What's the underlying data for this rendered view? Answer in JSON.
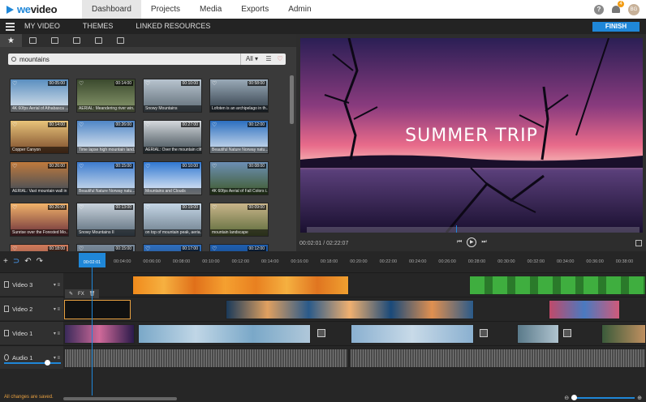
{
  "app": {
    "logo_text_we": "we",
    "logo_text_video": "video",
    "nav_tabs": [
      {
        "label": "Dashboard",
        "active": true
      },
      {
        "label": "Projects",
        "active": false
      },
      {
        "label": "Media",
        "active": false
      },
      {
        "label": "Exports",
        "active": false
      },
      {
        "label": "Admin",
        "active": false
      }
    ],
    "notification_count": "4",
    "avatar_initials": "BG",
    "help_label": "?"
  },
  "subbar": {
    "tabs": [
      "MY VIDEO",
      "THEMES",
      "LINKED RESOURCES"
    ],
    "finish_label": "FINISH"
  },
  "library": {
    "search_value": "mountains",
    "filter_label": "All",
    "thumbnails": [
      {
        "caption": "4K 60fps Aerial of Athabasca ...",
        "duration": "00:05:00",
        "c1": "#5a8fc0",
        "c2": "#dfe6ec"
      },
      {
        "caption": "AERIAL: Meandering river win...",
        "duration": "00:14:00",
        "c1": "#3b4a2e",
        "c2": "#8a9a6e"
      },
      {
        "caption": "Snowy Mountains",
        "duration": "00:10:00",
        "c1": "#b8c4cf",
        "c2": "#5d6a74"
      },
      {
        "caption": "Lofoten is an archipelago in th...",
        "duration": "00:58:00",
        "c1": "#9aaab8",
        "c2": "#2f3b46"
      },
      {
        "caption": "Copper Canyon",
        "duration": "00:14:00",
        "c1": "#e9c47a",
        "c2": "#7a4a2a"
      },
      {
        "caption": "Time lapse high mountain land...",
        "duration": "00:26:00",
        "c1": "#4f86c6",
        "c2": "#e8eef4"
      },
      {
        "caption": "AERIAL: Over the mountain cliff",
        "duration": "00:27:00",
        "c1": "#d5d9dd",
        "c2": "#3d4a52"
      },
      {
        "caption": "Beautiful Nature Norway natu...",
        "duration": "00:12:00",
        "c1": "#2b6fbf",
        "c2": "#dce7f2"
      },
      {
        "caption": "AERIAL: Vast mountain wall in ...",
        "duration": "00:26:00",
        "c1": "#c07a3c",
        "c2": "#3a4a5a"
      },
      {
        "caption": "Beautiful Nature Norway natu...",
        "duration": "00:15:00",
        "c1": "#3d7ccf",
        "c2": "#d9e4ee"
      },
      {
        "caption": "Mountains and Clouds",
        "duration": "00:10:00",
        "c1": "#2f77d1",
        "c2": "#eef3f8"
      },
      {
        "caption": "4K 60fps Aerial of Fall Colors i...",
        "duration": "00:08:00",
        "c1": "#6c8fb5",
        "c2": "#3f5a2a"
      },
      {
        "caption": "Sunrise over the Forested Mo...",
        "duration": "00:26:00",
        "c1": "#f2b36a",
        "c2": "#6a2f3a"
      },
      {
        "caption": "Snowy Mountains II",
        "duration": "00:13:00",
        "c1": "#c9d3dc",
        "c2": "#5a6b7a"
      },
      {
        "caption": "on top of mountain peak, aeria...",
        "duration": "00:19:00",
        "c1": "#c5d6e6",
        "c2": "#6b7c8a"
      },
      {
        "caption": "mountain landscape",
        "duration": "00:09:00",
        "c1": "#c9b58a",
        "c2": "#5b6a3a"
      },
      {
        "caption": "",
        "duration": "00:18:00",
        "c1": "#d07a5a",
        "c2": "#5a3a3a"
      },
      {
        "caption": "",
        "duration": "00:15:00",
        "c1": "#7a8a9a",
        "c2": "#3a4a5a"
      },
      {
        "caption": "",
        "duration": "00:17:00",
        "c1": "#2f6fbf",
        "c2": "#1a3a5a"
      },
      {
        "caption": "",
        "duration": "00:12:00",
        "c1": "#1f5faf",
        "c2": "#0f2f5f"
      }
    ]
  },
  "preview": {
    "overlay_title": "SUMMER TRIP",
    "time_current": "00:02:01",
    "time_total": "02:22:07",
    "time_separator": " / "
  },
  "timeline": {
    "playhead_time": "00:02:01",
    "ruler_ticks": [
      "00:04:00",
      "00:06:00",
      "00:08:00",
      "00:10:00",
      "00:12:00",
      "00:14:00",
      "00:16:00",
      "00:18:00",
      "00:20:00",
      "00:22:00",
      "00:24:00",
      "00:26:00",
      "00:28:00",
      "00:30:00",
      "00:32:00",
      "00:34:00",
      "00:36:00",
      "00:38:00"
    ],
    "tracks": [
      {
        "name": "Video 3"
      },
      {
        "name": "Video 2"
      },
      {
        "name": "Video 1"
      },
      {
        "name": "Audio 1"
      }
    ],
    "clip_tools": {
      "fx_label": "FX"
    },
    "status_text": "All changes are saved."
  },
  "colors": {
    "accent": "#1f87d8",
    "selection": "#e8a040"
  }
}
